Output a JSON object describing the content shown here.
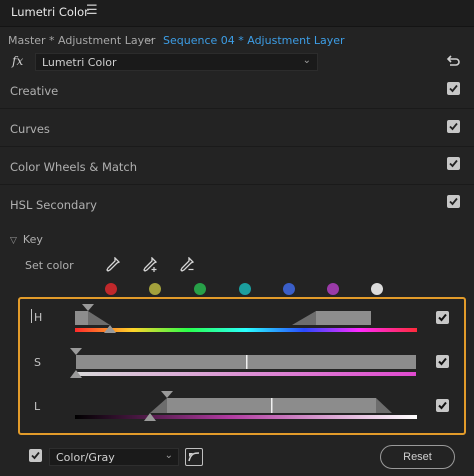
{
  "panel": {
    "title": "Lumetri Color",
    "menu_icon": "hamburger-icon"
  },
  "clip": {
    "master": "Master * Adjustment Layer",
    "sequence": "Sequence 04 * Adjustment Layer"
  },
  "effect": {
    "fx": "fx",
    "name": "Lumetri Color"
  },
  "sections": [
    {
      "label": "Creative",
      "checked": true
    },
    {
      "label": "Curves",
      "checked": true
    },
    {
      "label": "Color Wheels & Match",
      "checked": true
    },
    {
      "label": "HSL Secondary",
      "checked": true
    }
  ],
  "key": {
    "label": "Key",
    "set_color_label": "Set color"
  },
  "swatches": [
    "#c0282b",
    "#a3a13c",
    "#27a048",
    "#1b9e9e",
    "#3a5ec8",
    "#9a3aa8",
    "#dcdcdc"
  ],
  "ranges": {
    "h_label": "H",
    "s_label": "S",
    "l_label": "L",
    "h_checked": true,
    "s_checked": true,
    "l_checked": true
  },
  "bottom": {
    "mode": "Color/Gray",
    "reset": "Reset",
    "enabled": true
  },
  "colors": {
    "accent": "#e29b2a",
    "link": "#3d9ee6"
  }
}
